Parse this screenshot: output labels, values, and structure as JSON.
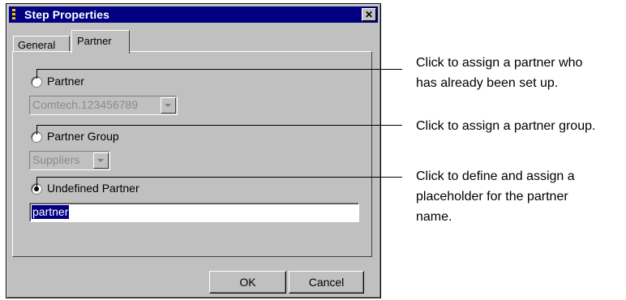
{
  "dialog": {
    "title": "Step Properties",
    "close_glyph": "✕",
    "tabs": [
      {
        "label": "General"
      },
      {
        "label": "Partner"
      }
    ],
    "active_tab": "Partner"
  },
  "partner_tab": {
    "options": [
      {
        "label": "Partner",
        "checked": false,
        "combo_value": "Comtech.123456789",
        "combo_disabled": true
      },
      {
        "label": "Partner Group",
        "checked": false,
        "combo_value": "Suppliers",
        "combo_disabled": true
      },
      {
        "label": "Undefined Partner",
        "checked": true,
        "field_value": "partner",
        "field_selected": true
      }
    ]
  },
  "buttons": {
    "ok": "OK",
    "cancel": "Cancel"
  },
  "callouts": [
    "Click to assign a partner who\nhas already been set up.",
    "Click to assign a partner group.",
    "Click to define and assign a\nplaceholder for the partner\nname."
  ],
  "colors": {
    "titlebar": "#000080",
    "face": "#c0c0c0",
    "selection": "#000080",
    "title_icon": "#f2c800"
  }
}
